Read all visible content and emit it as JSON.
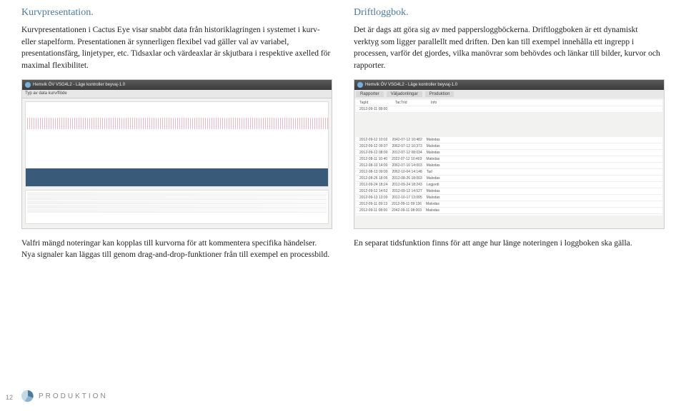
{
  "left": {
    "heading": "Kurvpresentation.",
    "body": "Kurvpresentationen i Cactus Eye visar snabbt data från historiklagringen i systemet i kurv- eller stapelform. Presentationen är synnerligen flexibel vad gäller val av variabel, presentationsfärg, linjetyper, etc. Tidsaxlar och värdeaxlar är skjutbara i respektive axelled för maximal flexibilitet."
  },
  "right": {
    "heading": "Driftloggbok.",
    "body": "Det är dags att göra sig av med pappersloggböckerna. Driftloggboken är ett dynamiskt verktyg som ligger parallellt med driften. Den kan till exempel innehålla ett ingrepp i processen, varför det gjordes, vilka manövrar som behövdes och länkar till bilder, kurvor och rapporter."
  },
  "screenshot_left": {
    "window_title": "Hemvik ÖV VSG4L2 - Läge kontroller beyvaj-1.0",
    "toolbar": "Typ av data kurv/flöde"
  },
  "screenshot_right": {
    "window_title": "Hemvik ÖV VSG4L2 - Läge kontroller beyvaj-1.0",
    "tabs": [
      "Rapporter",
      "Väljadonlingar",
      "Produktion"
    ]
  },
  "caption_left": "Valfri mängd noteringar kan kopplas till kurvorna för att kommentera specifika händelser. Nya signaler kan läggas till genom drag-and-drop-funktioner från till exempel en processbild.",
  "caption_right": "En separat tidsfunktion finns för att ange hur länge noteringen i loggboken ska gälla.",
  "footer": {
    "page_number": "12",
    "brand": "PRODUKTION"
  }
}
